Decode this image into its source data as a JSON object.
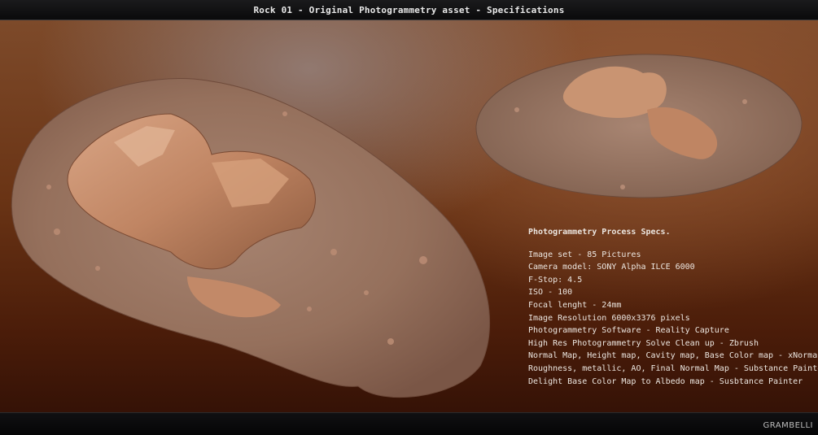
{
  "header": {
    "title": "Rock 01 - Original Photogrammetry asset - Specifications"
  },
  "specs": {
    "heading": "Photogrammetry Process Specs.",
    "lines": [
      "Image set - 85 Pictures",
      "Camera model: SONY Alpha ILCE 6000",
      "F-Stop: 4.5",
      "ISO - 100",
      "Focal lenght - 24mm",
      "Image Resolution 6000x3376 pixels",
      "Photogrammetry Software - Reality Capture",
      "High Res Photogrammetry Solve Clean up - Zbrush",
      "Normal Map, Height map, Cavity map, Base Color map - xNormal",
      "Roughness, metallic, AO, Final Normal Map - Substance Painter",
      "Delight Base Color Map to Albedo map - Susbtance Painter"
    ]
  },
  "footer": {
    "logo": "GRAMBELLI"
  },
  "colors": {
    "bar": "#0b0b0c",
    "background": "#6a3415",
    "text": "#ece6e0",
    "ground": "#9b7661",
    "rock": "#c98f6d"
  }
}
